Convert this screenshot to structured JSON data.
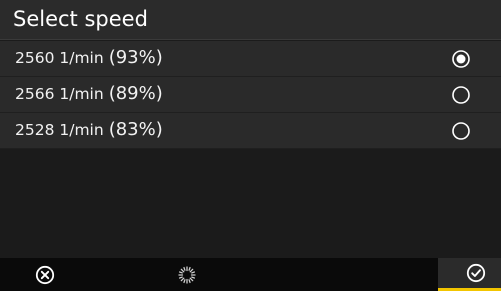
{
  "header": {
    "title": "Select speed"
  },
  "options": [
    {
      "speed": "2560 1/min",
      "percent": "(93%)",
      "selected": true
    },
    {
      "speed": "2566 1/min",
      "percent": "(89%)",
      "selected": false
    },
    {
      "speed": "2528 1/min",
      "percent": "(83%)",
      "selected": false
    }
  ],
  "footer": {
    "cancel_icon": "close-circle-icon",
    "busy_icon": "spinner-icon",
    "confirm_icon": "check-circle-icon",
    "accent": "#f2c500"
  }
}
